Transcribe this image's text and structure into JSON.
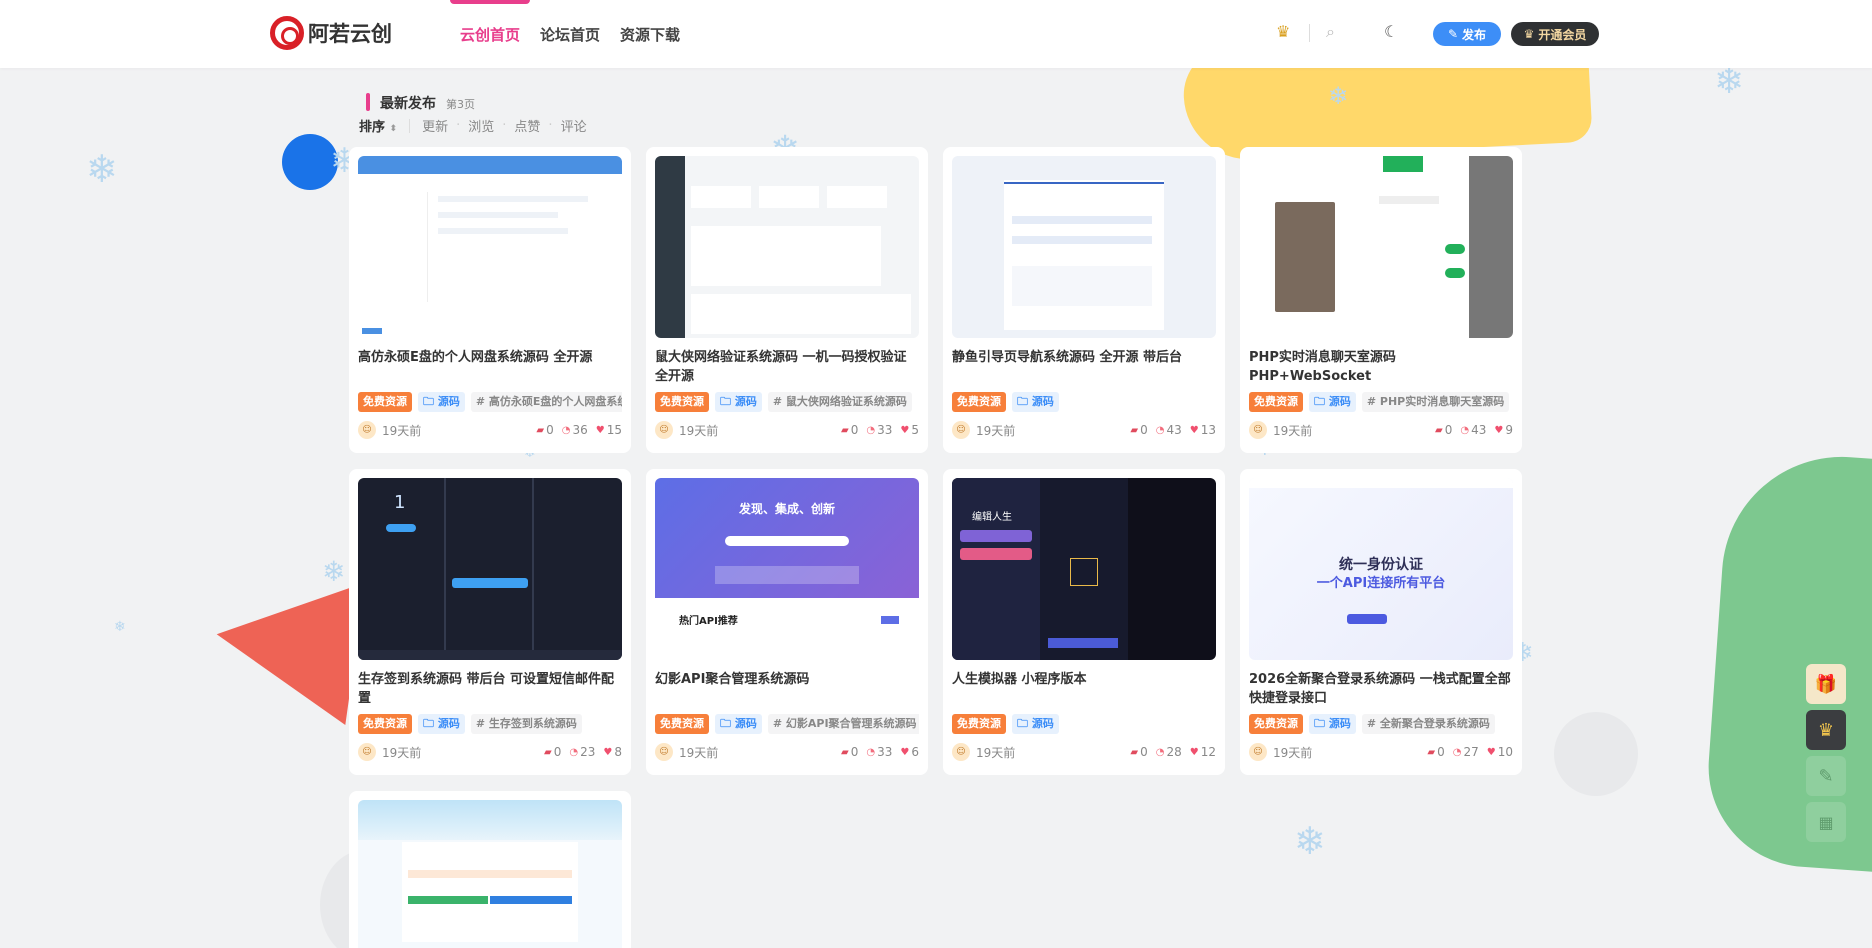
{
  "header": {
    "logo_text": "阿若云创",
    "nav": [
      {
        "label": "云创首页",
        "active": true
      },
      {
        "label": "论坛首页",
        "active": false
      },
      {
        "label": "资源下载",
        "active": false
      }
    ],
    "publish_label": "发布",
    "vip_label": "开通会员"
  },
  "section": {
    "title": "最新发布",
    "page": "第3页",
    "sort_label": "排序",
    "sort_options": [
      "更新",
      "浏览",
      "点赞",
      "评论"
    ]
  },
  "cards": [
    {
      "title": "高仿永硕E盘的个人网盘系统源码 全开源",
      "tags": [
        "免费资源",
        "源码",
        "# 高仿永硕E盘的个人网盘系统"
      ],
      "time": "19天前",
      "comments": "0",
      "views": "36",
      "likes": "15",
      "theme": "light-blue"
    },
    {
      "title": "鼠大侠网络验证系统源码 一机一码授权验证 全开源",
      "tags": [
        "免费资源",
        "源码",
        "# 鼠大侠网络验证系统源码"
      ],
      "time": "19天前",
      "comments": "0",
      "views": "33",
      "likes": "5",
      "theme": "dashboard"
    },
    {
      "title": "静鱼引导页导航系统源码 全开源 带后台",
      "tags": [
        "免费资源",
        "源码"
      ],
      "time": "19天前",
      "comments": "0",
      "views": "43",
      "likes": "13",
      "theme": "nav-light"
    },
    {
      "title": "PHP实时消息聊天室源码 PHP+WebSocket",
      "tags": [
        "免费资源",
        "源码",
        "# PHP实时消息聊天室源码"
      ],
      "time": "19天前",
      "comments": "0",
      "views": "43",
      "likes": "9",
      "theme": "chat"
    },
    {
      "title": "生存签到系统源码 带后台 可设置短信邮件配置",
      "tags": [
        "免费资源",
        "源码",
        "# 生存签到系统源码"
      ],
      "time": "19天前",
      "comments": "0",
      "views": "23",
      "likes": "8",
      "theme": "dark-app"
    },
    {
      "title": "幻影API聚合管理系统源码",
      "tags": [
        "免费资源",
        "源码",
        "# 幻影API聚合管理系统源码"
      ],
      "time": "19天前",
      "comments": "0",
      "views": "33",
      "likes": "6",
      "theme": "purple"
    },
    {
      "title": "人生模拟器 小程序版本",
      "tags": [
        "免费资源",
        "源码"
      ],
      "time": "19天前",
      "comments": "0",
      "views": "28",
      "likes": "12",
      "theme": "game"
    },
    {
      "title": "2026全新聚合登录系统源码 一栈式配置全部快捷登录接口",
      "tags": [
        "免费资源",
        "源码",
        "# 全新聚合登录系统源码"
      ],
      "time": "19天前",
      "comments": "0",
      "views": "27",
      "likes": "10",
      "theme": "auth"
    },
    {
      "title": "",
      "tags": [],
      "time": "",
      "comments": "",
      "views": "",
      "likes": "",
      "theme": "sky"
    }
  ],
  "thumb_text": {
    "purple_headline": "发现、集成、创新",
    "purple_sub": "热门API推荐",
    "auth_line1": "统一身份认证",
    "auth_line2": "一个API连接所有平台",
    "game_title": "编辑人生",
    "dark_number": "1"
  },
  "colors": {
    "accent": "#e83e8c",
    "publish": "#3d8ef7",
    "vip_bg": "#2f3133",
    "free_tag": "#f77f3a"
  },
  "fab_icons": [
    "gift-icon",
    "crown-icon",
    "edit-icon",
    "qrcode-icon"
  ]
}
